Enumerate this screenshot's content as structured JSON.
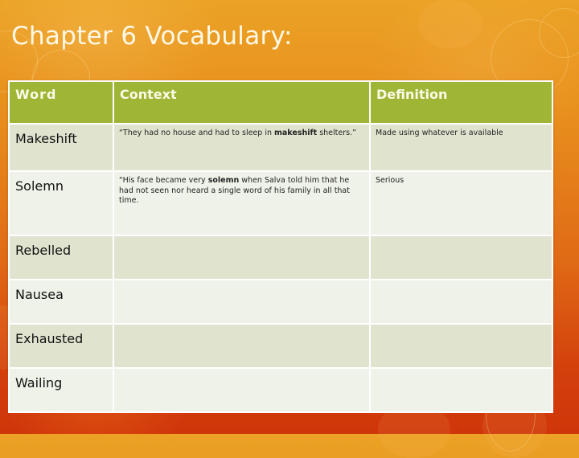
{
  "slide": {
    "title": "Chapter 6 Vocabulary:"
  },
  "table": {
    "headers": {
      "word": "Word",
      "context": "Context",
      "definition": "Definition"
    },
    "rows": [
      {
        "word": "Makeshift",
        "context_before": "“They had no house and had to sleep in ",
        "context_keyword": "makeshift",
        "context_after": " shelters.”",
        "definition": "Made using whatever is available"
      },
      {
        "word": "Solemn",
        "context_before": "“His face became very ",
        "context_keyword": "solemn",
        "context_after": " when Salva told him that he had not seen nor heard a single word of his family in all that time.",
        "definition": "Serious"
      },
      {
        "word": "Rebelled",
        "context_before": "",
        "context_keyword": "",
        "context_after": "",
        "definition": ""
      },
      {
        "word": "Nausea",
        "context_before": "",
        "context_keyword": "",
        "context_after": "",
        "definition": ""
      },
      {
        "word": "Exhausted",
        "context_before": "",
        "context_keyword": "",
        "context_after": "",
        "definition": ""
      },
      {
        "word": "Wailing",
        "context_before": "",
        "context_keyword": "",
        "context_after": "",
        "definition": ""
      }
    ]
  },
  "colors": {
    "header_bg": "#9fb535",
    "row_odd_bg": "#e0e4cf",
    "row_even_bg": "#eff2e8",
    "background_top": "#eba225",
    "background_bottom": "#cf360a"
  }
}
